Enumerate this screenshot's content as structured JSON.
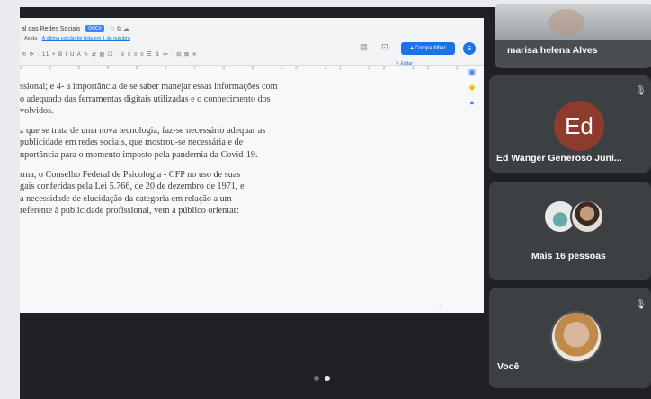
{
  "doc": {
    "title": "al das Redes Sociais",
    "badge": "DOCX",
    "title_icons": "☆ ⧉ ☁",
    "menu_prefix": "r Ajuda",
    "last_edit": "A última edição foi feita em 1 de outubro",
    "toolbar": "⟲ ⟳ · 11 + B I U A ✎ ⇄ ▤ ☐ · ≡ ≡ ≡ ≡ ☰ ⇅ ≔ · ⊟ ⊠ ✕",
    "share_label": "Compartilhar",
    "account_initial": "S",
    "edit_mode": "Editar",
    "ruler": "1 2 3 4 5 6 7 8 9 10 11 12 13 14",
    "paragraphs": [
      {
        "line1": "ssional; e 4- a importância de se saber manejar essas informações com",
        "line2": "o adequado das ferramentas digitais utilizadas e o conhecimento dos",
        "line3": "volvidos."
      },
      {
        "line1": "z que se trata de uma nova tecnologia, faz-se necessário adequar as",
        "line2_a": "publicidade em redes sociais, que mostrou-se necessária ",
        "line2_u": "e de",
        "line3": "nportância para o momento imposto pela pandemia da Covid-19."
      },
      {
        "line1": "rma, o Conselho Federal de Psicologia - CFP no uso de suas",
        "line2": "gais conferidas pela Lei 5.766, de 20 de dezembro de 1971, e",
        "line3": "a necessidade de elucidação da categoria em relação a um",
        "line4": "referente à publicidade profissional, vem a público orientar:"
      }
    ]
  },
  "participants": [
    {
      "name": "marisa helena Alves",
      "type": "camera"
    },
    {
      "name": "Ed Wanger Generoso Juni...",
      "initials": "Ed",
      "avatar_color": "#8d3b2d",
      "muted": true
    },
    {
      "name": "Mais 16 pessoas",
      "type": "group"
    },
    {
      "name": "Você",
      "type": "self",
      "muted": true
    }
  ],
  "pager": {
    "pages": 2,
    "current": 2
  }
}
